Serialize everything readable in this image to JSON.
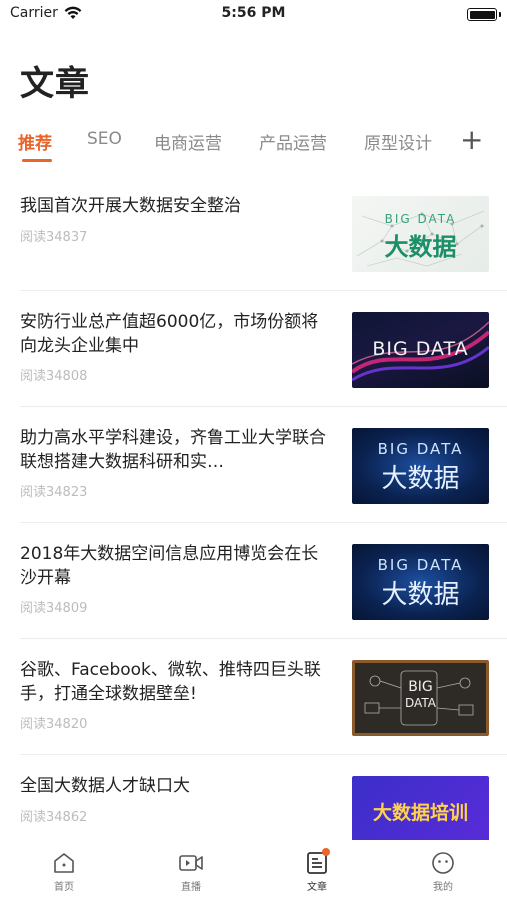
{
  "status_bar": {
    "carrier": "Carrier",
    "time": "5:56 PM"
  },
  "page_title": "文章",
  "tabs": [
    {
      "label": "推荐",
      "active": true
    },
    {
      "label": "SEO",
      "active": false
    },
    {
      "label": "电商运营",
      "active": false
    },
    {
      "label": "产品运营",
      "active": false
    },
    {
      "label": "原型设计",
      "active": false
    }
  ],
  "tab_add": "+",
  "articles": [
    {
      "title": "我国首次开展大数据安全整治",
      "reads": "阅读34837",
      "thumb": {
        "line1": "BIG DATA",
        "line2": "大数据"
      }
    },
    {
      "title": "安防行业总产值超6000亿，市场份额将向龙头企业集中",
      "reads": "阅读34808",
      "thumb": {
        "line1": "BIG DATA"
      }
    },
    {
      "title": "助力高水平学科建设，齐鲁工业大学联合联想搭建大数据科研和实…",
      "reads": "阅读34823",
      "thumb": {
        "line1": "BIG DATA",
        "line2": "大数据"
      }
    },
    {
      "title": "2018年大数据空间信息应用博览会在长沙开幕",
      "reads": "阅读34809",
      "thumb": {
        "line1": "BIG DATA",
        "line2": "大数据"
      }
    },
    {
      "title": "谷歌、Facebook、微软、推特四巨头联手，打通全球数据壁垒!",
      "reads": "阅读34820",
      "thumb": {
        "line1": "BIG",
        "line2": "DATA"
      }
    },
    {
      "title": "全国大数据人才缺口大",
      "reads": "阅读34862",
      "thumb": {
        "line1": "大数据培训"
      }
    }
  ],
  "tabbar": [
    {
      "label": "首页",
      "icon": "home-icon",
      "active": false
    },
    {
      "label": "直播",
      "icon": "video-icon",
      "active": false
    },
    {
      "label": "文章",
      "icon": "article-icon",
      "active": true
    },
    {
      "label": "我的",
      "icon": "profile-icon",
      "active": false
    }
  ],
  "colors": {
    "accent": "#e8652c",
    "text": "#222222",
    "muted": "#bcbcbc"
  }
}
